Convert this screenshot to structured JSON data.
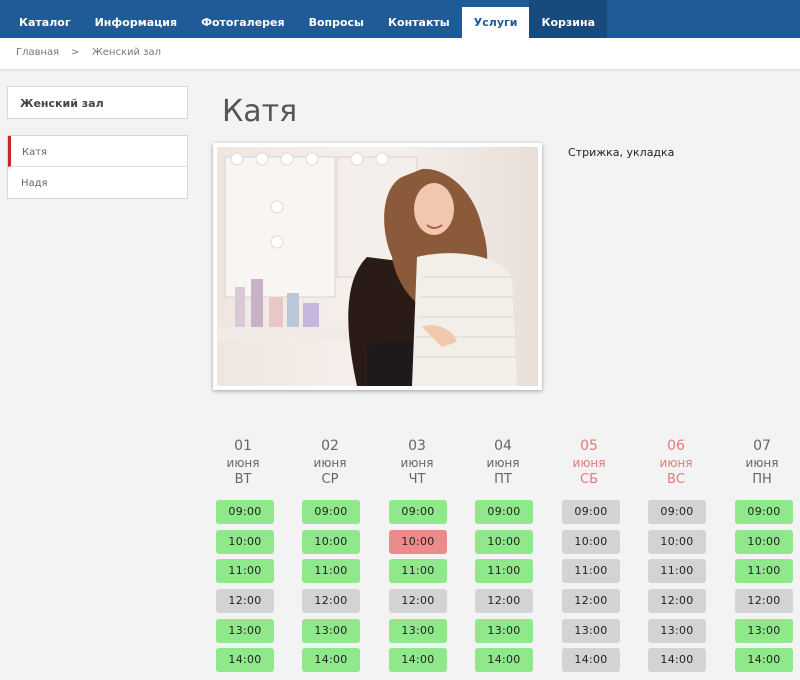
{
  "nav": [
    {
      "label": "Каталог",
      "state": "normal"
    },
    {
      "label": "Информация",
      "state": "normal"
    },
    {
      "label": "Фотогалерея",
      "state": "normal"
    },
    {
      "label": "Вопросы",
      "state": "normal"
    },
    {
      "label": "Контакты",
      "state": "normal"
    },
    {
      "label": "Услуги",
      "state": "active"
    },
    {
      "label": "Корзина",
      "state": "cart"
    }
  ],
  "breadcrumb": {
    "home": "Главная",
    "separator": ">",
    "current": "Женский зал"
  },
  "sidebar": {
    "heading": "Женский зал",
    "items": [
      {
        "label": "Катя",
        "active": true
      },
      {
        "label": "Надя",
        "active": false
      }
    ]
  },
  "master": {
    "name": "Катя",
    "service": "Стрижка, укладка"
  },
  "colors": {
    "nav_bg": "#1f5b96",
    "free": "#8fe88a",
    "busy": "#d3d3d3",
    "booked": "#ec8b8b",
    "weekend_text": "#e07a7a"
  },
  "schedule": {
    "days": [
      {
        "num": "01",
        "month": "июня",
        "dow": "ВТ",
        "weekend": false
      },
      {
        "num": "02",
        "month": "июня",
        "dow": "СР",
        "weekend": false
      },
      {
        "num": "03",
        "month": "июня",
        "dow": "ЧТ",
        "weekend": false
      },
      {
        "num": "04",
        "month": "июня",
        "dow": "ПТ",
        "weekend": false
      },
      {
        "num": "05",
        "month": "июня",
        "dow": "СБ",
        "weekend": true
      },
      {
        "num": "06",
        "month": "июня",
        "dow": "ВС",
        "weekend": true
      },
      {
        "num": "07",
        "month": "июня",
        "dow": "ПН",
        "weekend": false
      }
    ],
    "times": [
      "09:00",
      "10:00",
      "11:00",
      "12:00",
      "13:00",
      "14:00"
    ],
    "status": [
      [
        "free",
        "free",
        "free",
        "free",
        "busy",
        "busy",
        "free"
      ],
      [
        "free",
        "free",
        "booked",
        "free",
        "busy",
        "busy",
        "free"
      ],
      [
        "free",
        "free",
        "free",
        "free",
        "busy",
        "busy",
        "free"
      ],
      [
        "busy",
        "busy",
        "busy",
        "busy",
        "busy",
        "busy",
        "busy"
      ],
      [
        "free",
        "free",
        "free",
        "free",
        "busy",
        "busy",
        "free"
      ],
      [
        "free",
        "free",
        "free",
        "free",
        "busy",
        "busy",
        "free"
      ]
    ]
  }
}
